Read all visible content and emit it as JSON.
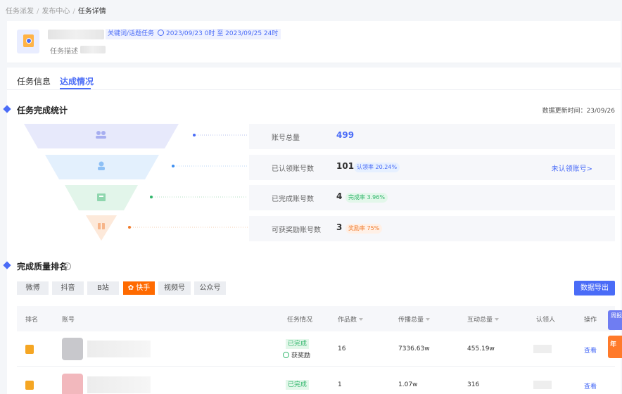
{
  "breadcrumb": {
    "items": [
      "任务派发",
      "发布中心",
      "任务详情"
    ]
  },
  "task": {
    "type_tag": "关键词/话题任务",
    "date_range": "2023/09/23 0时 至 2023/09/25 24时",
    "desc_label": "任务描述"
  },
  "tabs": [
    {
      "label": "任务信息"
    },
    {
      "label": "达成情况"
    }
  ],
  "completion": {
    "title": "任务完成统计",
    "update_time": "数据更新时间：23/09/26",
    "rows": [
      {
        "label": "账号总量",
        "value": "499"
      },
      {
        "label": "已认领账号数",
        "value": "101",
        "badge": "认领率 20.24%",
        "link": "未认领账号>"
      },
      {
        "label": "已完成账号数",
        "value": "4",
        "badge": "完成率 3.96%"
      },
      {
        "label": "可获奖励账号数",
        "value": "3",
        "badge": "奖励率 75%"
      }
    ]
  },
  "ranking": {
    "title": "完成质量排名",
    "platforms": [
      "微博",
      "抖音",
      "B站",
      "快手",
      "视频号",
      "公众号"
    ],
    "active_platform": "快手",
    "export_label": "数据导出",
    "columns": [
      "排名",
      "账号",
      "任务情况",
      "作品数",
      "传播总量",
      "互动总量",
      "认领人",
      "操作"
    ],
    "rows": [
      {
        "status": "已完成",
        "reward": "获奖励",
        "works": "16",
        "spread": "7336.63w",
        "interact": "455.19w",
        "action": "查看"
      },
      {
        "status": "已完成",
        "works": "1",
        "spread": "1.07w",
        "interact": "316",
        "action": "查看"
      }
    ]
  },
  "floats": {
    "first": "周报",
    "second": "年"
  },
  "colors": {
    "primary": "#4a6cf7",
    "active_platform": "#ff6a00",
    "success": "#2fb56a",
    "warning": "#f07a2a"
  }
}
